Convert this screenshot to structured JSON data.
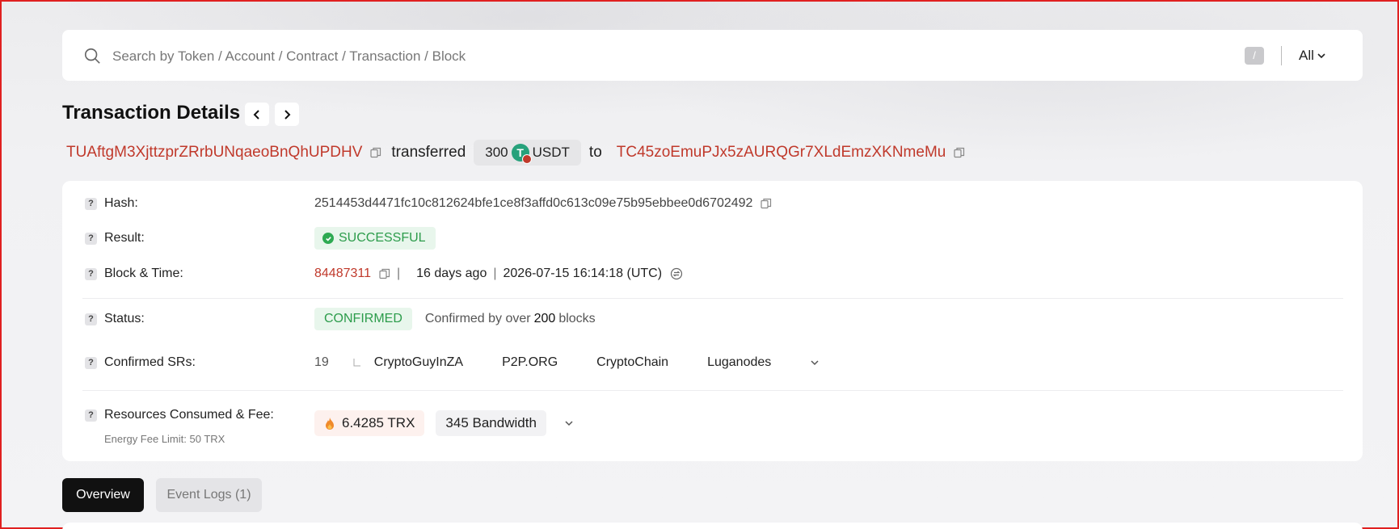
{
  "search": {
    "placeholder": "Search by Token / Account / Contract / Transaction / Block",
    "shortcut": "/",
    "filter": "All"
  },
  "page": {
    "title": "Transaction Details"
  },
  "transfer": {
    "from": "TUAftgM3XjttzprZRrbUNqaeoBnQhUPDHV",
    "verb": "transferred",
    "amount": "300",
    "token": "USDT",
    "to_word": "to",
    "to": "TC45zoEmuPJx5zAURQGr7XLdEmzXKNmeMu"
  },
  "details": {
    "hash_label": "Hash:",
    "hash": "2514453d4471fc10c812624bfe1ce8f3affd0c613c09e75b95ebbee0d6702492",
    "result_label": "Result:",
    "result": "SUCCESSFUL",
    "block_label": "Block & Time:",
    "block": "84487311",
    "age": "16 days ago",
    "time": "2026-07-15 16:14:18 (UTC)",
    "status_label": "Status:",
    "status": "CONFIRMED",
    "confirmed_prefix": "Confirmed by over",
    "confirmed_count": "200",
    "confirmed_suffix": "blocks",
    "srs_label": "Confirmed SRs:",
    "srs_count": "19",
    "srs": [
      "CryptoGuyInZA",
      "P2P.ORG",
      "CryptoChain",
      "Luganodes"
    ],
    "resources_label": "Resources Consumed & Fee:",
    "energy_limit": "Energy Fee Limit: 50 TRX",
    "fee_trx": "6.4285 TRX",
    "bandwidth": "345 Bandwidth"
  },
  "tabs": {
    "overview": "Overview",
    "event_logs": "Event Logs (1)"
  },
  "colors": {
    "address": "#c0392b",
    "success": "#2c9c4b",
    "tether": "#26a17b"
  }
}
